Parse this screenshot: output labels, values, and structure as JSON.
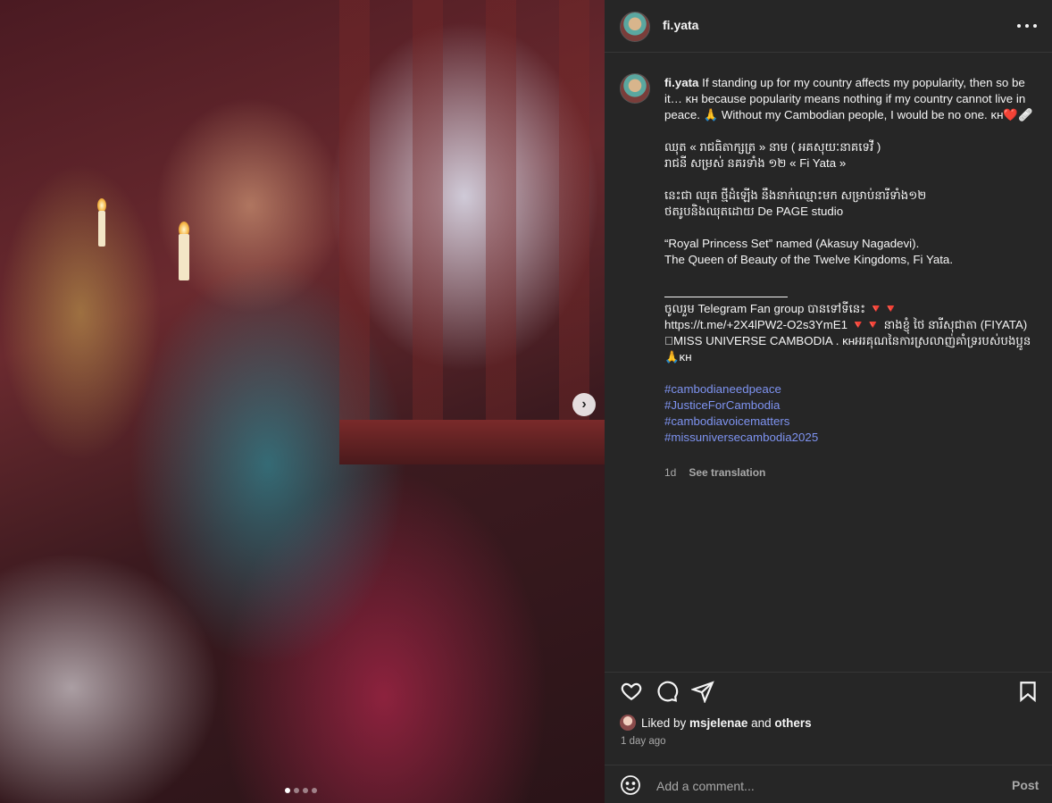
{
  "post": {
    "username": "fi.yata",
    "carousel": {
      "current": 1,
      "total": 4
    }
  },
  "caption": {
    "username": "fi.yata",
    "line1": " If standing up for my country affects my popularity, then so be it… ᴋʜ because popularity means nothing if my country cannot live in peace. 🙏 Without my Cambodian people, I would be no one. ᴋʜ❤️🩹",
    "khmer1": "ឈុត « រាជធិតាក្សត្រ » នាម ( អគសុយៈនាគទេវី )",
    "khmer2": "រាជនី សម្រស់ នគរទាំង ១២ « Fi Yata »",
    "khmer3": "នេះជា ឈុត ថ្មីដំឡើង នឹងនាក់ឈ្មោះមក សម្រាប់នារីទាំង១២",
    "khmer4": "ថតរូបនិងឈុតដោយ De PAGE studio",
    "english1": "“Royal Princess Set” named (Akasuy Nagadevi).",
    "english2": "The Queen of Beauty of the Twelve Kingdoms, Fi Yata.",
    "telegram1": "ចូលរួម Telegram Fan group បានទៅទីនេះ 🔻🔻",
    "telegram2": "https://t.me/+2X4lPW2-O2s3YmE1 🔻🔻 នាងខ្ញុំ ថៃ នារីសុជាតា (FIYATA) 􏰀MISS UNIVERSE CAMBODIA . ᴋʜអរគុណនៃការស្រលាញ់គាំទ្ររបស់បងប្អូន 🙏ᴋʜ",
    "hashtags": [
      "#cambodianeedpeace",
      "#JusticeForCambodia",
      "#cambodiavoicematters",
      "#missuniversecambodia2025"
    ],
    "age": "1d",
    "see_translation": "See translation"
  },
  "engagement": {
    "liked_by_prefix": "Liked by ",
    "liked_by_user": "msjelenae",
    "liked_by_and": " and ",
    "liked_by_others": "others",
    "posted_time": "1 day ago"
  },
  "comment": {
    "placeholder": "Add a comment...",
    "post_label": "Post"
  },
  "icons": {
    "like": "heart-icon",
    "comment": "comment-icon",
    "share": "share-icon",
    "save": "bookmark-icon",
    "more": "more-icon",
    "next": "chevron-right-icon",
    "emoji": "emoji-icon"
  },
  "colors": {
    "panel_bg": "#262626",
    "text": "#f5f5f5",
    "muted": "#a8a8a8",
    "hashtag": "#7e93f0"
  }
}
